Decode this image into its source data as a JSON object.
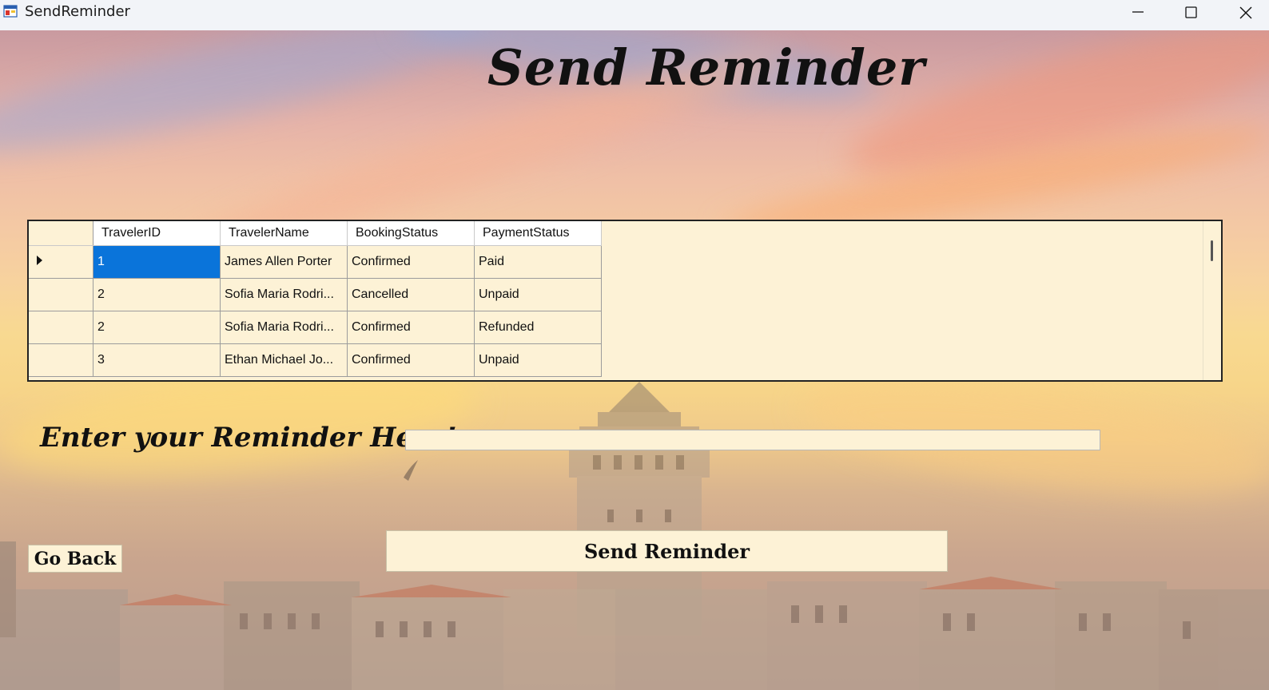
{
  "window": {
    "title": "SendReminder"
  },
  "heading": "Send Reminder",
  "grid": {
    "columns": [
      "TravelerID",
      "TravelerName",
      "BookingStatus",
      "PaymentStatus"
    ],
    "rows": [
      {
        "traveler_id": "1",
        "traveler_name": "James Allen Porter",
        "booking_status": "Confirmed",
        "payment_status": "Paid"
      },
      {
        "traveler_id": "2",
        "traveler_name": "Sofia Maria Rodri...",
        "booking_status": "Cancelled",
        "payment_status": "Unpaid"
      },
      {
        "traveler_id": "2",
        "traveler_name": "Sofia Maria Rodri...",
        "booking_status": "Confirmed",
        "payment_status": "Refunded"
      },
      {
        "traveler_id": "3",
        "traveler_name": "Ethan Michael Jo...",
        "booking_status": "Confirmed",
        "payment_status": "Unpaid"
      }
    ],
    "selected_color": "#0a74da"
  },
  "reminder": {
    "label": "Enter your Reminder Here!",
    "value": ""
  },
  "buttons": {
    "send": "Send Reminder",
    "back": "Go Back"
  },
  "icons": {
    "app": "app-form-icon",
    "minimize": "minimize-icon",
    "maximize": "maximize-icon",
    "close": "close-icon",
    "row_marker": "current-row-arrow-icon"
  }
}
